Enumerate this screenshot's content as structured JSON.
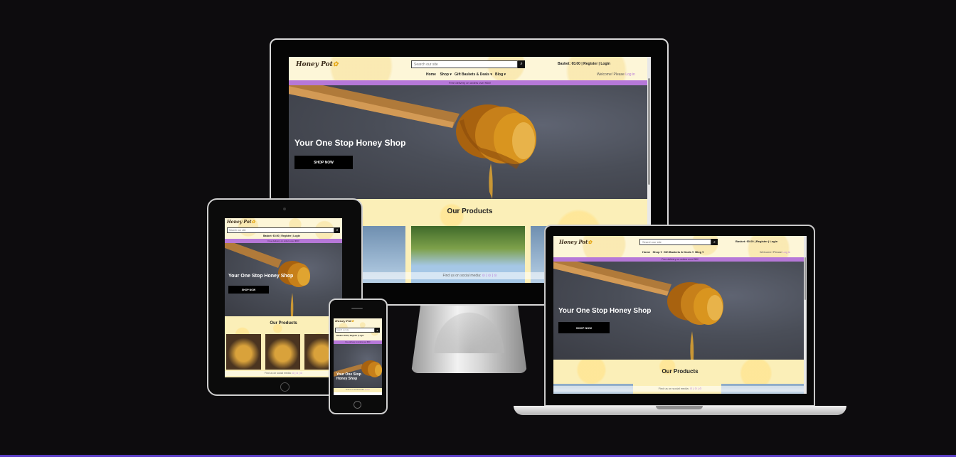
{
  "site": {
    "logo": "Honey Pot",
    "search_placeholder": "Search our site",
    "basket": "Basket: €0.00",
    "register": "Register",
    "login": "Login",
    "nav": [
      "Home",
      "Shop",
      "Gift Baskets & Deals",
      "Blog"
    ],
    "welcome": "Welcome! Please",
    "welcome_link": "Log in",
    "banner": "Free delivery on orders over €60!",
    "hero_title": "Your One Stop Honey Shop",
    "shop_button": "SHOP NOW",
    "products_title": "Our Products",
    "social": "Find us on social media:"
  },
  "colors": {
    "background": "#0d0c0e",
    "banner": "#b678d8",
    "honeycomb": "#fbefb8",
    "accent_line": "#5b3fc7"
  }
}
